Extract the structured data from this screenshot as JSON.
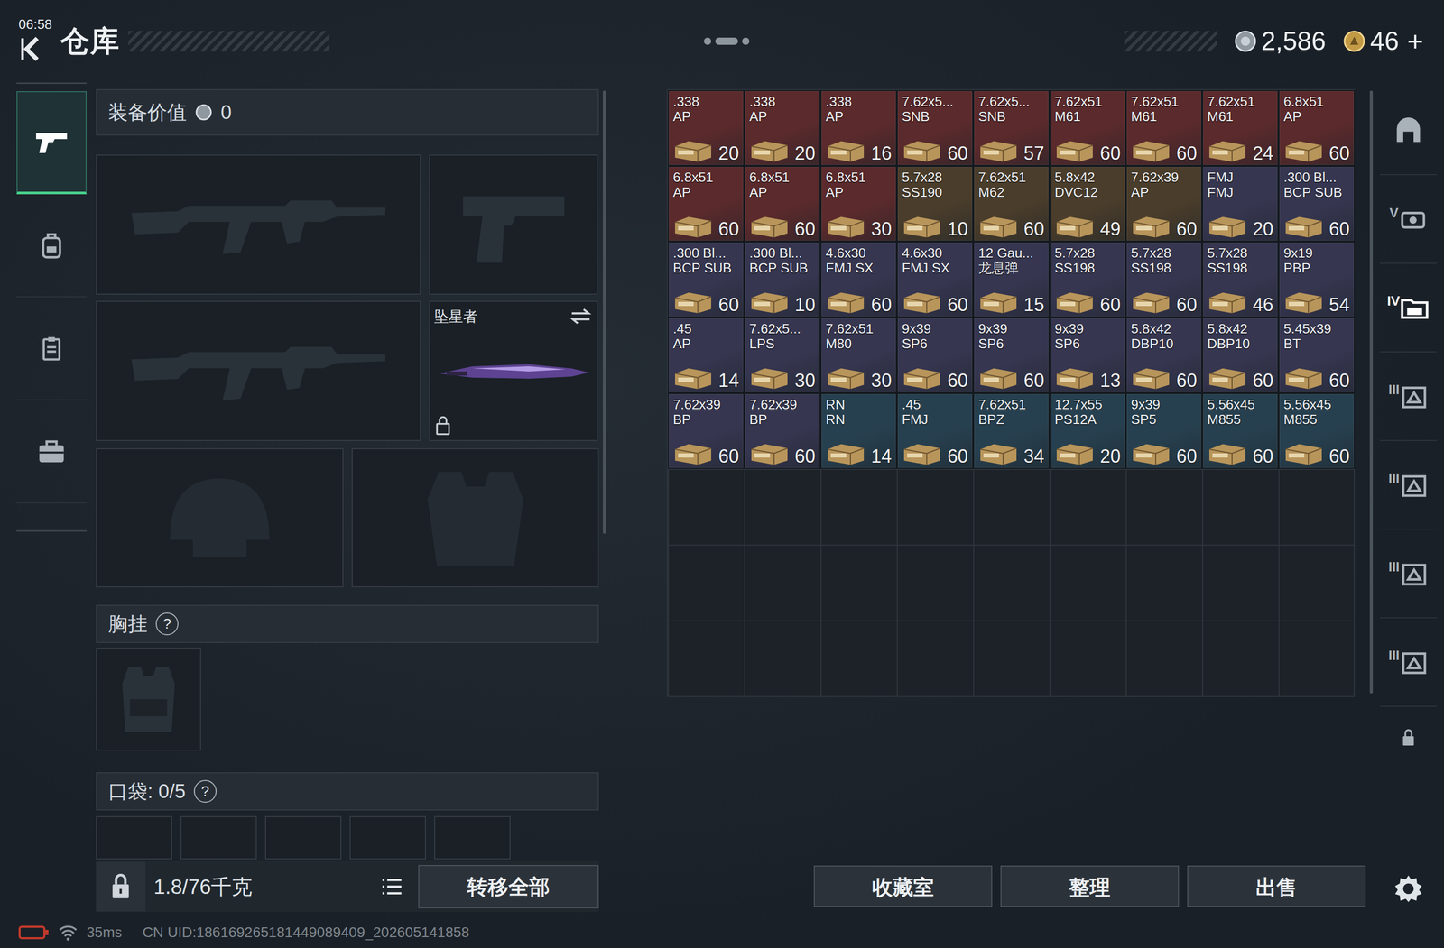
{
  "status": {
    "time": "06:58"
  },
  "header": {
    "title": "仓库",
    "currencies": [
      {
        "amount": "2,586"
      },
      {
        "amount": "46"
      }
    ],
    "add": "+"
  },
  "nav": [
    {
      "selected": true
    },
    {
      "selected": false
    },
    {
      "selected": false
    },
    {
      "selected": false
    }
  ],
  "equipment": {
    "value_label": "装备价值",
    "value": "0",
    "melee": {
      "name": "坠星者",
      "locked": true
    },
    "chest_label": "胸挂",
    "chest_help": "?",
    "pocket_label": "口袋: 0/5",
    "pocket_help": "?"
  },
  "footer": {
    "weight": "1.8/76千克",
    "transfer": "转移全部"
  },
  "inventory": {
    "items": [
      {
        "caliber": ".338",
        "type": "AP",
        "count": "20",
        "color": "#5b2a2c"
      },
      {
        "caliber": ".338",
        "type": "AP",
        "count": "20",
        "color": "#5b2a2c"
      },
      {
        "caliber": ".338",
        "type": "AP",
        "count": "16",
        "color": "#5b2a2c"
      },
      {
        "caliber": "7.62x5...",
        "type": "SNB",
        "count": "60",
        "color": "#5b2a2c"
      },
      {
        "caliber": "7.62x5...",
        "type": "SNB",
        "count": "57",
        "color": "#5b2a2c"
      },
      {
        "caliber": "7.62x51",
        "type": "M61",
        "count": "60",
        "color": "#5b2a2c"
      },
      {
        "caliber": "7.62x51",
        "type": "M61",
        "count": "60",
        "color": "#5b2a2c"
      },
      {
        "caliber": "7.62x51",
        "type": "M61",
        "count": "24",
        "color": "#5b2a2c"
      },
      {
        "caliber": "6.8x51",
        "type": "AP",
        "count": "60",
        "color": "#5b2a2c"
      },
      {
        "caliber": "6.8x51",
        "type": "AP",
        "count": "60",
        "color": "#5b2a2c"
      },
      {
        "caliber": "6.8x51",
        "type": "AP",
        "count": "60",
        "color": "#5b2a2c"
      },
      {
        "caliber": "6.8x51",
        "type": "AP",
        "count": "30",
        "color": "#5b2a2c"
      },
      {
        "caliber": "5.7x28",
        "type": "SS190",
        "count": "10",
        "color": "#4a3d2b"
      },
      {
        "caliber": "7.62x51",
        "type": "M62",
        "count": "60",
        "color": "#4a3d2b"
      },
      {
        "caliber": "5.8x42",
        "type": "DVC12",
        "count": "49",
        "color": "#4a3d2b"
      },
      {
        "caliber": "7.62x39",
        "type": "AP",
        "count": "60",
        "color": "#4a3d2b"
      },
      {
        "caliber": "FMJ",
        "type": "FMJ",
        "count": "20",
        "color": "#363650"
      },
      {
        "caliber": ".300 Bl...",
        "type": "BCP SUB",
        "count": "60",
        "color": "#363650"
      },
      {
        "caliber": ".300 Bl...",
        "type": "BCP SUB",
        "count": "60",
        "color": "#363650"
      },
      {
        "caliber": ".300 Bl...",
        "type": "BCP SUB",
        "count": "10",
        "color": "#363650"
      },
      {
        "caliber": "4.6x30",
        "type": "FMJ SX",
        "count": "60",
        "color": "#363650"
      },
      {
        "caliber": "4.6x30",
        "type": "FMJ SX",
        "count": "60",
        "color": "#363650"
      },
      {
        "caliber": "12 Gau...",
        "type": "龙息弹",
        "count": "15",
        "color": "#363650"
      },
      {
        "caliber": "5.7x28",
        "type": "SS198",
        "count": "60",
        "color": "#363650"
      },
      {
        "caliber": "5.7x28",
        "type": "SS198",
        "count": "60",
        "color": "#363650"
      },
      {
        "caliber": "5.7x28",
        "type": "SS198",
        "count": "46",
        "color": "#363650"
      },
      {
        "caliber": "9x19",
        "type": "PBP",
        "count": "54",
        "color": "#363650"
      },
      {
        "caliber": ".45",
        "type": "AP",
        "count": "14",
        "color": "#363650"
      },
      {
        "caliber": "7.62x5...",
        "type": "LPS",
        "count": "30",
        "color": "#363650"
      },
      {
        "caliber": "7.62x51",
        "type": "M80",
        "count": "30",
        "color": "#363650"
      },
      {
        "caliber": "9x39",
        "type": "SP6",
        "count": "60",
        "color": "#363650"
      },
      {
        "caliber": "9x39",
        "type": "SP6",
        "count": "60",
        "color": "#363650"
      },
      {
        "caliber": "9x39",
        "type": "SP6",
        "count": "13",
        "color": "#363650"
      },
      {
        "caliber": "5.8x42",
        "type": "DBP10",
        "count": "60",
        "color": "#363650"
      },
      {
        "caliber": "5.8x42",
        "type": "DBP10",
        "count": "60",
        "color": "#363650"
      },
      {
        "caliber": "5.45x39",
        "type": "BT",
        "count": "60",
        "color": "#363650"
      },
      {
        "caliber": "7.62x39",
        "type": "BP",
        "count": "60",
        "color": "#363650"
      },
      {
        "caliber": "7.62x39",
        "type": "BP",
        "count": "60",
        "color": "#363650"
      },
      {
        "caliber": "RN",
        "type": "RN",
        "count": "14",
        "color": "#27404f"
      },
      {
        "caliber": ".45",
        "type": "FMJ",
        "count": "60",
        "color": "#27404f"
      },
      {
        "caliber": "7.62x51",
        "type": "BPZ",
        "count": "34",
        "color": "#27404f"
      },
      {
        "caliber": "12.7x55",
        "type": "PS12A",
        "count": "20",
        "color": "#27404f"
      },
      {
        "caliber": "9x39",
        "type": "SP5",
        "count": "60",
        "color": "#27404f"
      },
      {
        "caliber": "5.56x45",
        "type": "M855",
        "count": "60",
        "color": "#27404f"
      },
      {
        "caliber": "5.56x45",
        "type": "M855",
        "count": "60",
        "color": "#27404f"
      }
    ]
  },
  "actions": [
    "收藏室",
    "整理",
    "出售"
  ],
  "tabs": [
    {
      "selected": false
    },
    {
      "label": "V",
      "selected": false
    },
    {
      "label": "IV",
      "selected": true
    },
    {
      "label": "III",
      "selected": false
    },
    {
      "label": "III",
      "selected": false
    },
    {
      "label": "III",
      "selected": false
    },
    {
      "label": "III",
      "selected": false
    }
  ],
  "netbar": {
    "ping": "35ms",
    "uid": "CN UID:186169265181449089409_202605141858"
  }
}
